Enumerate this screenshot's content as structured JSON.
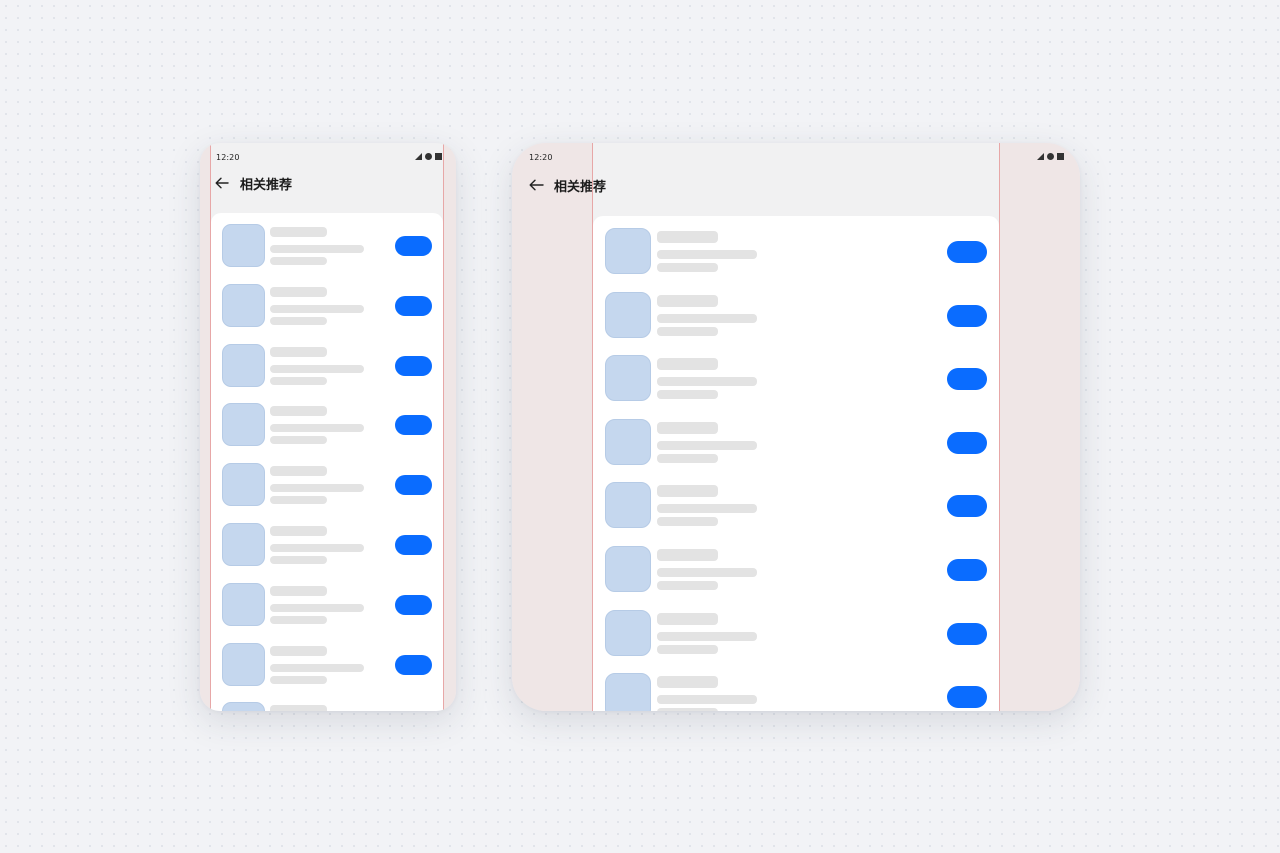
{
  "screens": [
    {
      "status_bar": {
        "time": "12:20",
        "signal_icon": "cellular-signal-icon",
        "dot_icon": "status-dot-icon",
        "battery_icon": "battery-icon"
      },
      "header": {
        "back_icon": "arrow-left-icon",
        "title": "相关推荐"
      },
      "list": {
        "visible_rows": 9,
        "button_color": "#0a6cff",
        "app_icon_color": "#c5d7ee",
        "placeholder_color": "#e3e3e3"
      }
    },
    {
      "status_bar": {
        "time": "12:20",
        "signal_icon": "cellular-signal-icon",
        "dot_icon": "status-dot-icon",
        "battery_icon": "battery-icon"
      },
      "header": {
        "back_icon": "arrow-left-icon",
        "title": "相关推荐"
      },
      "list": {
        "visible_rows": 8,
        "button_color": "#0a6cff",
        "app_icon_color": "#c5d7ee",
        "placeholder_color": "#e3e3e3"
      }
    }
  ],
  "colors": {
    "background": "#f2f3f6",
    "screen_background": "#f1f1f2",
    "card_background": "#ffffff",
    "margin_band": "#efe6e6",
    "guide_line": "#e7a7a7",
    "accent": "#0a6cff"
  }
}
